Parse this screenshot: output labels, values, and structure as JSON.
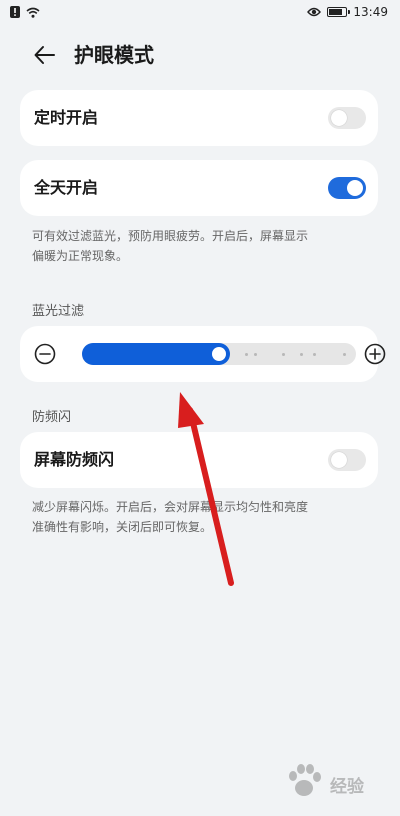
{
  "status_bar": {
    "time": "13:49",
    "icons": [
      "alert-icon",
      "wifi-icon",
      "eye-icon",
      "battery-icon"
    ]
  },
  "header": {
    "title": "护眼模式",
    "back_icon": "back-arrow-icon"
  },
  "timer": {
    "label": "定时开启",
    "enabled": false
  },
  "all_day": {
    "label": "全天开启",
    "enabled": true,
    "description": [
      "可有效过滤蓝光，预防用眼疲劳。开启后，屏幕显示",
      "偏暖为正常现象。"
    ]
  },
  "blue_light": {
    "section_title": "蓝光过滤",
    "level_fraction": 0.54,
    "steps": 5,
    "decrease_icon": "minus-circle-icon",
    "increase_icon": "plus-circle-icon"
  },
  "anti_flicker": {
    "section_title": "防频闪",
    "label": "屏幕防频闪",
    "enabled": false,
    "description": [
      "减少屏幕闪烁。开启后，会对屏幕显示均匀性和亮度",
      "准确性有影响，关闭后即可恢复。"
    ]
  },
  "colors": {
    "accent": "#1f6bdc",
    "slider_fill": "#0f5fd9",
    "annotation_arrow": "#d81e1e"
  },
  "watermark": {
    "text": "经验"
  }
}
